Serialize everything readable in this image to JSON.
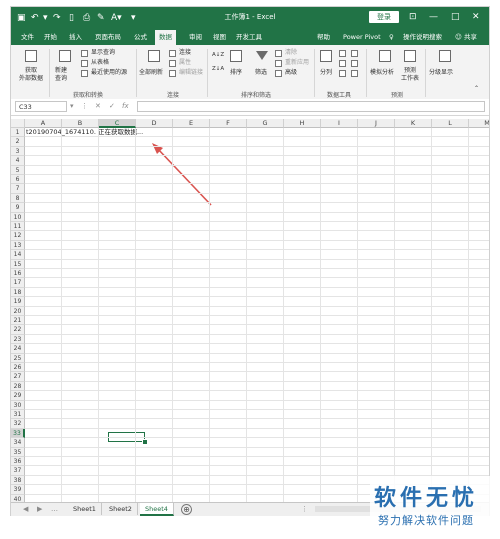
{
  "titlebar": {
    "title": "工作簿1 - Excel",
    "login_label": "登录",
    "window_controls": [
      "⊡",
      "—",
      "□",
      "✕"
    ]
  },
  "ribbon_tabs": [
    "文件",
    "开始",
    "插入",
    "页面布局",
    "公式",
    "数据",
    "审阅",
    "视图",
    "开发工具",
    "帮助",
    "Power Pivot",
    "操作说明搜索",
    "共享"
  ],
  "active_tab": "数据",
  "ribbon": {
    "get_data": "获取\n外部数据",
    "new_query": "新建\n查询",
    "show_queries": "显示查询",
    "from_table": "从表格",
    "recent_sources": "最近使用的源",
    "group_get_transform": "获取和转换",
    "refresh_all": "全部刷新",
    "connections": "连接",
    "properties": "属性",
    "edit_links": "编辑链接",
    "group_connections": "连接",
    "sort_az": "A↓Z",
    "sort_za": "Z↓A",
    "sort": "排序",
    "filter": "筛选",
    "clear": "清除",
    "reapply": "重新应用",
    "advanced": "高级",
    "group_sort_filter": "排序和筛选",
    "text_to_columns": "分列",
    "group_data_tools": "数据工具",
    "what_if": "模拟分析",
    "forecast_sheet": "预测\n工作表",
    "group_forecast": "预测",
    "outline": "分级显示"
  },
  "formula_bar": {
    "name_box": "C33",
    "cancel": "✕",
    "enter": "✓",
    "fx": "fx",
    "formula": ""
  },
  "columns": [
    "A",
    "B",
    "C",
    "D",
    "E",
    "F",
    "G",
    "H",
    "I",
    "J",
    "K",
    "L",
    "M"
  ],
  "rows": [
    "1",
    "2",
    "3",
    "4",
    "5",
    "6",
    "7",
    "8",
    "9",
    "10",
    "11",
    "12",
    "13",
    "14",
    "15",
    "16",
    "17",
    "18",
    "19",
    "20",
    "21",
    "22",
    "23",
    "24",
    "25",
    "26",
    "27",
    "28",
    "29",
    "30",
    "31",
    "32",
    "33",
    "34",
    "35",
    "36",
    "37",
    "38",
    "39",
    "40"
  ],
  "selected_cell": "C33",
  "cell_a1": "t20190704_1674110. 正在获取数据...",
  "sheet_tabs": [
    "Sheet1",
    "Sheet2",
    "Sheet4"
  ],
  "active_sheet": "Sheet4",
  "add_sheet": "⊕",
  "watermark": {
    "line1": "软件无忧",
    "line2": "努力解决软件问题"
  },
  "colors": {
    "excel_green": "#217346",
    "arrow": "#d9534f"
  }
}
